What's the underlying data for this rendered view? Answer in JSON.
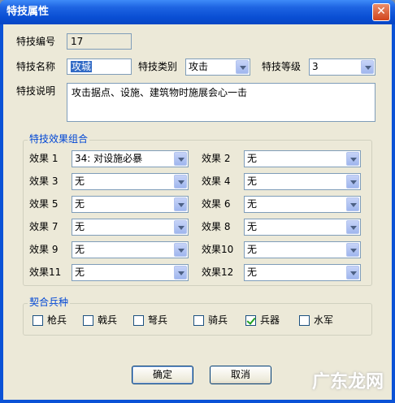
{
  "window": {
    "title": "特技属性",
    "close": "✕"
  },
  "fields": {
    "id_label": "特技编号",
    "id_value": "17",
    "name_label": "特技名称",
    "name_value": "攻城",
    "type_label": "特技类别",
    "type_value": "攻击",
    "level_label": "特技等级",
    "level_value": "3",
    "desc_label": "特技说明",
    "desc_value": "攻击据点、设施、建筑物时施展会心一击"
  },
  "effects_group": {
    "title": "特技效果组合",
    "items": [
      {
        "label": "效果 1",
        "value": "34: 对设施必暴"
      },
      {
        "label": "效果 2",
        "value": "无"
      },
      {
        "label": "效果 3",
        "value": "无"
      },
      {
        "label": "效果 4",
        "value": "无"
      },
      {
        "label": "效果 5",
        "value": "无"
      },
      {
        "label": "效果 6",
        "value": "无"
      },
      {
        "label": "效果 7",
        "value": "无"
      },
      {
        "label": "效果 8",
        "value": "无"
      },
      {
        "label": "效果 9",
        "value": "无"
      },
      {
        "label": "效果10",
        "value": "无"
      },
      {
        "label": "效果11",
        "value": "无"
      },
      {
        "label": "效果12",
        "value": "无"
      }
    ]
  },
  "troops_group": {
    "title": "契合兵种",
    "items": [
      {
        "label": "枪兵",
        "checked": false
      },
      {
        "label": "戟兵",
        "checked": false
      },
      {
        "label": "弩兵",
        "checked": false
      },
      {
        "label": "骑兵",
        "checked": false
      },
      {
        "label": "兵器",
        "checked": true
      },
      {
        "label": "水军",
        "checked": false
      }
    ]
  },
  "buttons": {
    "ok": "确定",
    "cancel": "取消"
  },
  "watermark": "广东龙网"
}
